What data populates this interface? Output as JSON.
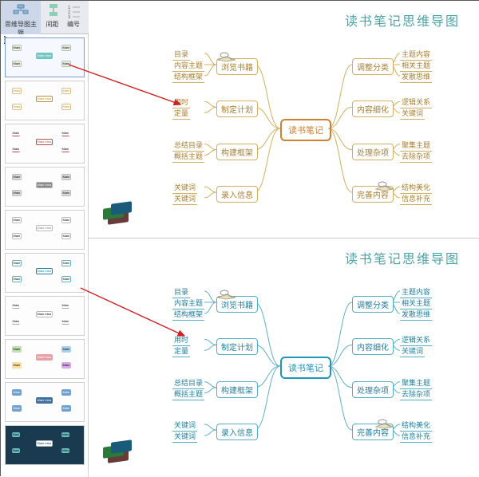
{
  "ribbon": {
    "main_theme": "思维导图主题",
    "spacing": "间距",
    "numbering": "编号"
  },
  "titles": {
    "top": "读书笔记思维导图",
    "bottom": "读书笔记思维导图"
  },
  "mindmap_top": {
    "center": "读书笔记",
    "left_branches": [
      {
        "label": "浏览书籍",
        "leaves": [
          "目录",
          "内容主题",
          "结构框架"
        ]
      },
      {
        "label": "制定计划",
        "leaves": [
          "用时",
          "定量"
        ]
      },
      {
        "label": "构建框架",
        "leaves": [
          "总结目录",
          "概括主题"
        ]
      },
      {
        "label": "录入信息",
        "leaves": [
          "关键词",
          "关键词"
        ]
      }
    ],
    "right_branches": [
      {
        "label": "调整分类",
        "leaves": [
          "主题内容",
          "相关主题",
          "发散思维"
        ]
      },
      {
        "label": "内容细化",
        "leaves": [
          "逻辑关系",
          "关键词"
        ]
      },
      {
        "label": "处理杂项",
        "leaves": [
          "聚集主题",
          "去除杂项"
        ]
      },
      {
        "label": "完善内容",
        "leaves": [
          "结构美化",
          "信息补充"
        ]
      }
    ]
  },
  "mindmap_bottom": {
    "center": "读书笔记",
    "left_branches": [
      {
        "label": "浏览书籍",
        "leaves": [
          "目录",
          "内容主题",
          "结构框架"
        ]
      },
      {
        "label": "制定计划",
        "leaves": [
          "用时",
          "定量"
        ]
      },
      {
        "label": "构建框架",
        "leaves": [
          "总结目录",
          "概括主题"
        ]
      },
      {
        "label": "录入信息",
        "leaves": [
          "关键词",
          "关键词"
        ]
      }
    ],
    "right_branches": [
      {
        "label": "调整分类",
        "leaves": [
          "主题内容",
          "相关主题",
          "发散思维"
        ]
      },
      {
        "label": "内容细化",
        "leaves": [
          "逻辑关系",
          "关键词"
        ]
      },
      {
        "label": "处理杂项",
        "leaves": [
          "聚集主题",
          "去除杂项"
        ]
      },
      {
        "label": "完善内容",
        "leaves": [
          "结构美化",
          "信息补充"
        ]
      }
    ]
  }
}
